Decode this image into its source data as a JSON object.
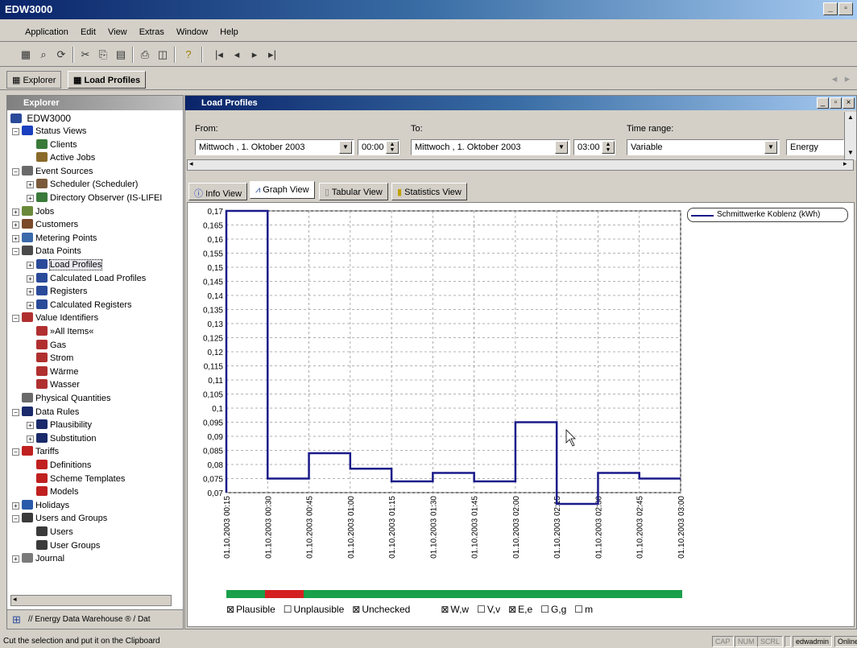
{
  "app": {
    "title": "EDW3000"
  },
  "menu": [
    "Application",
    "Edit",
    "View",
    "Extras",
    "Window",
    "Help"
  ],
  "doc_tabs": {
    "explorer": "Explorer",
    "load_profiles": "Load Profiles"
  },
  "explorer": {
    "title": "Explorer",
    "root": "EDW3000",
    "items": [
      {
        "label": "Status Views",
        "level": 1,
        "exp": "-",
        "color": "#1a3fbf"
      },
      {
        "label": "Clients",
        "level": 2,
        "exp": "",
        "color": "#3a7a3a"
      },
      {
        "label": "Active Jobs",
        "level": 2,
        "exp": "",
        "color": "#8a6a2a"
      },
      {
        "label": "Event Sources",
        "level": 1,
        "exp": "-",
        "color": "#6a6a6a"
      },
      {
        "label": "Scheduler (Scheduler)",
        "level": 2,
        "exp": "+",
        "color": "#7a5a3a"
      },
      {
        "label": "Directory Observer (IS-LIFEI",
        "level": 2,
        "exp": "+",
        "color": "#3a7a3a"
      },
      {
        "label": "Jobs",
        "level": 1,
        "exp": "+",
        "color": "#6a8a3a"
      },
      {
        "label": "Customers",
        "level": 1,
        "exp": "+",
        "color": "#7a4a2a"
      },
      {
        "label": "Metering Points",
        "level": 1,
        "exp": "+",
        "color": "#3a6aaa"
      },
      {
        "label": "Data Points",
        "level": 1,
        "exp": "-",
        "color": "#4a4a4a"
      },
      {
        "label": "Load Profiles",
        "level": 2,
        "exp": "+",
        "color": "#2a4a9a",
        "selected": true
      },
      {
        "label": "Calculated Load Profiles",
        "level": 2,
        "exp": "+",
        "color": "#2a4a9a"
      },
      {
        "label": "Registers",
        "level": 2,
        "exp": "+",
        "color": "#2a4a9a"
      },
      {
        "label": "Calculated Registers",
        "level": 2,
        "exp": "+",
        "color": "#2a4a9a"
      },
      {
        "label": "Value Identifiers",
        "level": 1,
        "exp": "-",
        "color": "#b03030"
      },
      {
        "label": "»All Items«",
        "level": 2,
        "exp": "",
        "color": "#b03030"
      },
      {
        "label": "Gas",
        "level": 2,
        "exp": "",
        "color": "#b03030"
      },
      {
        "label": "Strom",
        "level": 2,
        "exp": "",
        "color": "#b03030"
      },
      {
        "label": "Wärme",
        "level": 2,
        "exp": "",
        "color": "#b03030"
      },
      {
        "label": "Wasser",
        "level": 2,
        "exp": "",
        "color": "#b03030"
      },
      {
        "label": "Physical Quantities",
        "level": 1,
        "exp": "",
        "color": "#6a6a6a"
      },
      {
        "label": "Data Rules",
        "level": 1,
        "exp": "-",
        "color": "#1a2a6a"
      },
      {
        "label": "Plausibility",
        "level": 2,
        "exp": "+",
        "color": "#1a2a6a"
      },
      {
        "label": "Substitution",
        "level": 2,
        "exp": "+",
        "color": "#1a2a6a"
      },
      {
        "label": "Tariffs",
        "level": 1,
        "exp": "-",
        "color": "#c02020"
      },
      {
        "label": "Definitions",
        "level": 2,
        "exp": "",
        "color": "#c02020"
      },
      {
        "label": "Scheme Templates",
        "level": 2,
        "exp": "",
        "color": "#c02020"
      },
      {
        "label": "Models",
        "level": 2,
        "exp": "",
        "color": "#c02020"
      },
      {
        "label": "Holidays",
        "level": 1,
        "exp": "+",
        "color": "#2a5aaa"
      },
      {
        "label": "Users and Groups",
        "level": 1,
        "exp": "-",
        "color": "#3a3a3a"
      },
      {
        "label": "Users",
        "level": 2,
        "exp": "",
        "color": "#3a3a3a"
      },
      {
        "label": "User Groups",
        "level": 2,
        "exp": "",
        "color": "#3a3a3a"
      },
      {
        "label": "Journal",
        "level": 1,
        "exp": "+",
        "color": "#7a7a7a"
      }
    ],
    "footer": "// Energy Data Warehouse ® / Dat"
  },
  "load_profiles": {
    "title": "Load Profiles",
    "from_label": "From:",
    "to_label": "To:",
    "time_range_label": "Time range:",
    "from_date": "Mittwoch ,  1.  Oktober  2003",
    "from_time": "00:00",
    "to_date": "Mittwoch ,  1.  Oktober  2003",
    "to_time": "03:00",
    "time_range": "Variable",
    "quantity": "Energy",
    "view_tabs": [
      "Info View",
      "Graph View",
      "Tabular View",
      "Statistics View"
    ],
    "legend": "Schmittwerke Koblenz (kWh)",
    "checks": [
      {
        "label": "Plausible",
        "checked": true
      },
      {
        "label": "Unplausible",
        "checked": false
      },
      {
        "label": "Unchecked",
        "checked": true
      },
      {
        "label": "W,w",
        "checked": true
      },
      {
        "label": "V,v",
        "checked": false
      },
      {
        "label": "E,e",
        "checked": true
      },
      {
        "label": "G,g",
        "checked": false
      },
      {
        "label": "m",
        "checked": false
      }
    ],
    "quality_bar": {
      "good_color": "#1aa04a",
      "bad_color": "#d42020",
      "bad_from_fraction": 0.085,
      "bad_to_fraction": 0.17
    }
  },
  "chart_data": {
    "type": "line",
    "step": true,
    "x_ticks": [
      "01.10.2003 00:15",
      "01.10.2003 00:30",
      "01.10.2003 00:45",
      "01.10.2003 01:00",
      "01.10.2003 01:15",
      "01.10.2003 01:30",
      "01.10.2003 01:45",
      "01.10.2003 02:00",
      "01.10.2003 02:15",
      "01.10.2003 02:30",
      "01.10.2003 02:45",
      "01.10.2003 03:00"
    ],
    "y_ticks": [
      "0,07",
      "0,075",
      "0,08",
      "0,085",
      "0,09",
      "0,095",
      "0,1",
      "0,105",
      "0,11",
      "0,115",
      "0,12",
      "0,125",
      "0,13",
      "0,135",
      "0,14",
      "0,145",
      "0,15",
      "0,155",
      "0,16",
      "0,165",
      "0,17"
    ],
    "ylim": [
      0.07,
      0.17
    ],
    "series": [
      {
        "name": "Schmittwerke Koblenz (kWh)",
        "color": "#1a1a8a",
        "values": [
          0.17,
          0.075,
          0.084,
          0.0785,
          0.074,
          0.077,
          0.074,
          0.095,
          0.066,
          0.077,
          0.075
        ]
      }
    ]
  },
  "status": {
    "text": "Cut the selection and put it on the Clipboard",
    "cells": [
      "CAP",
      "NUM",
      "SCRL",
      "",
      "edwadmin",
      "Online"
    ]
  }
}
